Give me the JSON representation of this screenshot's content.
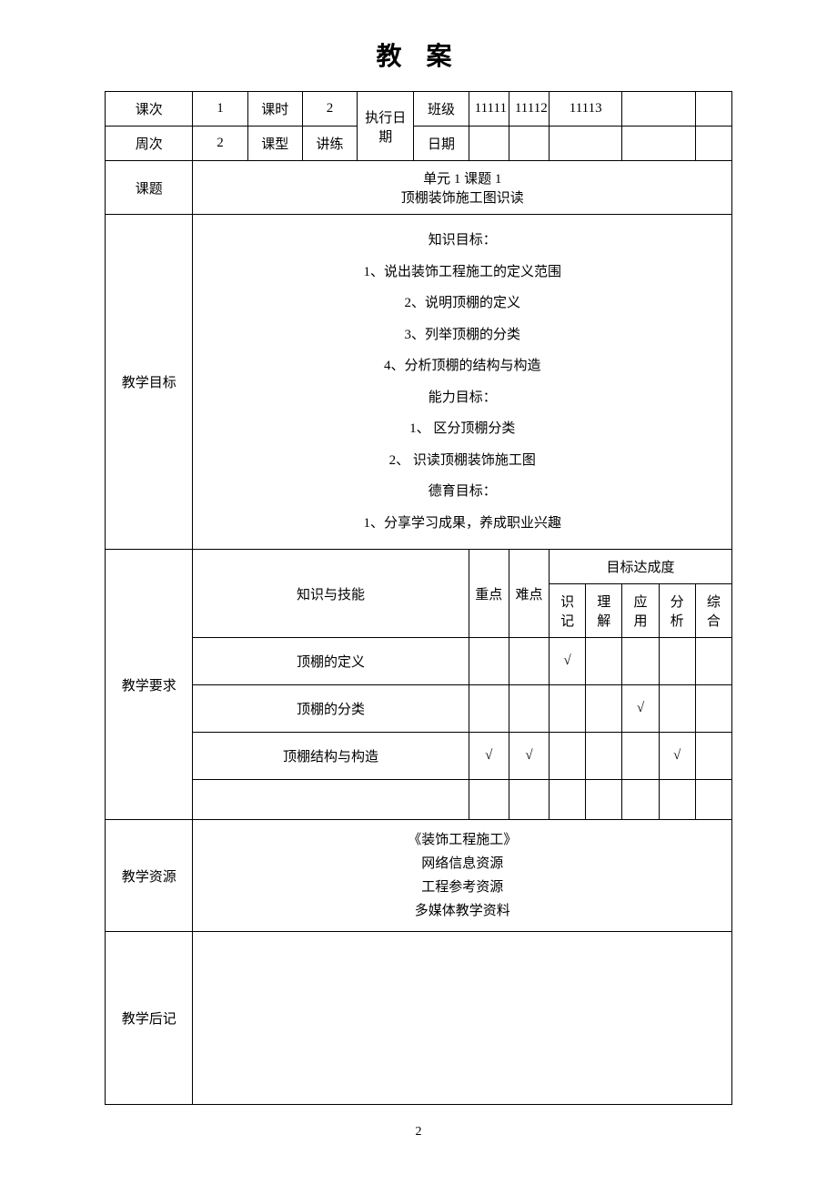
{
  "title": "教 案",
  "header": {
    "row1": {
      "keci_label": "课次",
      "keci_val": "1",
      "keshi_label": "课时",
      "keshi_val": "2",
      "zhixing_riqi_label": "执行日期",
      "banji_label": "班级",
      "cls1": "11111",
      "cls2": "11112",
      "cls3": "11113"
    },
    "row2": {
      "zhouci_label": "周次",
      "zhouci_val": "2",
      "kexing_label": "课型",
      "kexing_val": "讲练",
      "riqi_label": "日期"
    }
  },
  "keti": {
    "label": "课题",
    "line1": "单元 1 课题 1",
    "line2": "顶棚装饰施工图识读"
  },
  "mubiao": {
    "label": "教学目标",
    "zs_label": "知识目标：",
    "zs1": "1、说出装饰工程施工的定义范围",
    "zs2": "2、说明顶棚的定义",
    "zs3": "3、列举顶棚的分类",
    "zs4": "4、分析顶棚的结构与构造",
    "nl_label": "能力目标：",
    "nl1": "1、 区分顶棚分类",
    "nl2": "2、 识读顶棚装饰施工图",
    "dy_label": "德育目标：",
    "dy1": "1、分享学习成果，养成职业兴趣"
  },
  "yaoqiu": {
    "label": "教学要求",
    "col_knowledge": "知识与技能",
    "col_key": "重点",
    "col_diff": "难点",
    "col_goal": "目标达成度",
    "sub": {
      "c1": "识记",
      "c2": "理解",
      "c3": "应用",
      "c4": "分析",
      "c5": "综合"
    },
    "rows": [
      {
        "name": "顶棚的定义",
        "key": "",
        "diff": "",
        "c1": "√",
        "c2": "",
        "c3": "",
        "c4": "",
        "c5": ""
      },
      {
        "name": "顶棚的分类",
        "key": "",
        "diff": "",
        "c1": "",
        "c2": "",
        "c3": "√",
        "c4": "",
        "c5": ""
      },
      {
        "name": "顶棚结构与构造",
        "key": "√",
        "diff": "√",
        "c1": "",
        "c2": "",
        "c3": "",
        "c4": "√",
        "c5": ""
      }
    ]
  },
  "ziyuan": {
    "label": "教学资源",
    "r1": "《装饰工程施工》",
    "r2": "网络信息资源",
    "r3": "工程参考资源",
    "r4": "多媒体教学资料"
  },
  "houji": {
    "label": "教学后记"
  },
  "page_num": "2"
}
